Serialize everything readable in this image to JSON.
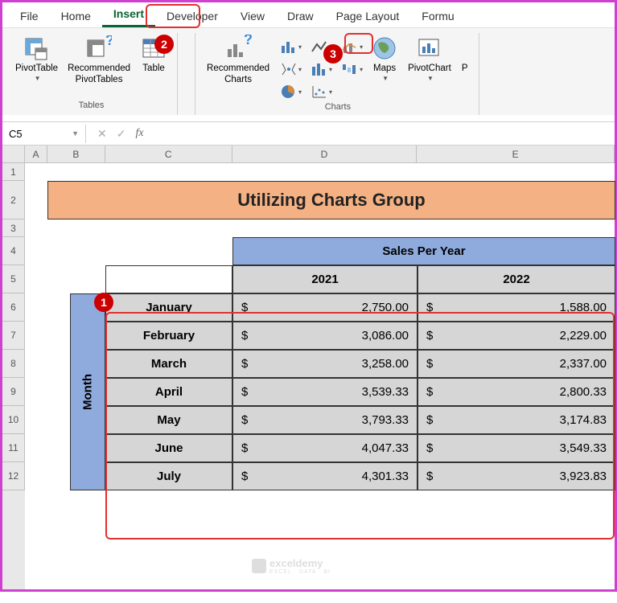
{
  "tabs": {
    "file": "File",
    "home": "Home",
    "insert": "Insert",
    "developer": "Developer",
    "view": "View",
    "draw": "Draw",
    "page_layout": "Page Layout",
    "formulas": "Formu"
  },
  "ribbon": {
    "tables": {
      "pivot_table": "PivotTable",
      "recommended_pivot": "Recommended\nPivotTables",
      "table": "Table",
      "group_label": "Tables"
    },
    "charts": {
      "recommended": "Recommended\nCharts",
      "maps": "Maps",
      "pivot_chart": "PivotChart",
      "group_label": "Charts"
    }
  },
  "name_box": "C5",
  "fx": "fx",
  "col_headers": [
    "A",
    "B",
    "C",
    "D",
    "E"
  ],
  "row_headers": [
    "1",
    "2",
    "3",
    "4",
    "5",
    "6",
    "7",
    "8",
    "9",
    "10",
    "11",
    "12"
  ],
  "sheet": {
    "title": "Utilizing Charts Group",
    "sales_header": "Sales Per Year",
    "month_header": "Month",
    "year1": "2021",
    "year2": "2022",
    "rows": [
      {
        "month": "January",
        "y1": "2,750.00",
        "y2": "1,588.00"
      },
      {
        "month": "February",
        "y1": "3,086.00",
        "y2": "2,229.00"
      },
      {
        "month": "March",
        "y1": "3,258.00",
        "y2": "2,337.00"
      },
      {
        "month": "April",
        "y1": "3,539.33",
        "y2": "2,800.33"
      },
      {
        "month": "May",
        "y1": "3,793.33",
        "y2": "3,174.83"
      },
      {
        "month": "June",
        "y1": "4,047.33",
        "y2": "3,549.33"
      },
      {
        "month": "July",
        "y1": "4,301.33",
        "y2": "3,923.83"
      }
    ],
    "currency": "$"
  },
  "callouts": {
    "c1": "1",
    "c2": "2",
    "c3": "3"
  },
  "watermark": {
    "name": "exceldemy",
    "sub": "EXCEL · DATA · BI"
  }
}
